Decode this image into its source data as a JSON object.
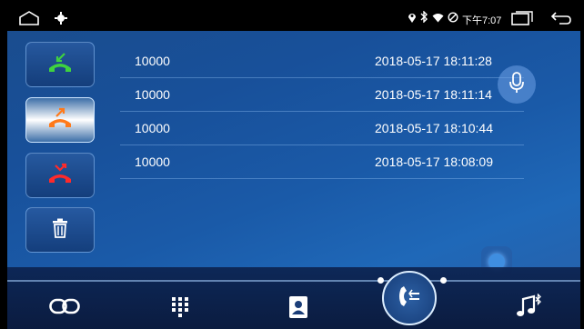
{
  "status_bar": {
    "time": "下午7:07",
    "icons": [
      "location-icon",
      "bluetooth-icon",
      "wifi-icon",
      "no-sim-icon"
    ]
  },
  "filter_buttons": [
    {
      "name": "received-calls",
      "icon": "call-received-icon",
      "color": "#3fd23f",
      "active": false
    },
    {
      "name": "dialed-calls",
      "icon": "call-outgoing-icon",
      "color": "#ff7a1a",
      "active": true
    },
    {
      "name": "missed-calls",
      "icon": "call-missed-icon",
      "color": "#ff2a2a",
      "active": false
    },
    {
      "name": "delete",
      "icon": "trash-icon",
      "color": "#ffffff",
      "active": false
    }
  ],
  "calls": [
    {
      "number": "10000",
      "time": "2018-05-17 18:11:28"
    },
    {
      "number": "10000",
      "time": "2018-05-17 18:11:14"
    },
    {
      "number": "10000",
      "time": "2018-05-17 18:10:44"
    },
    {
      "number": "10000",
      "time": "2018-05-17 18:08:09"
    }
  ],
  "bottom_nav": [
    "link-icon",
    "dialpad-icon",
    "contacts-icon",
    "call-log-icon",
    "bluetooth-music-icon"
  ]
}
